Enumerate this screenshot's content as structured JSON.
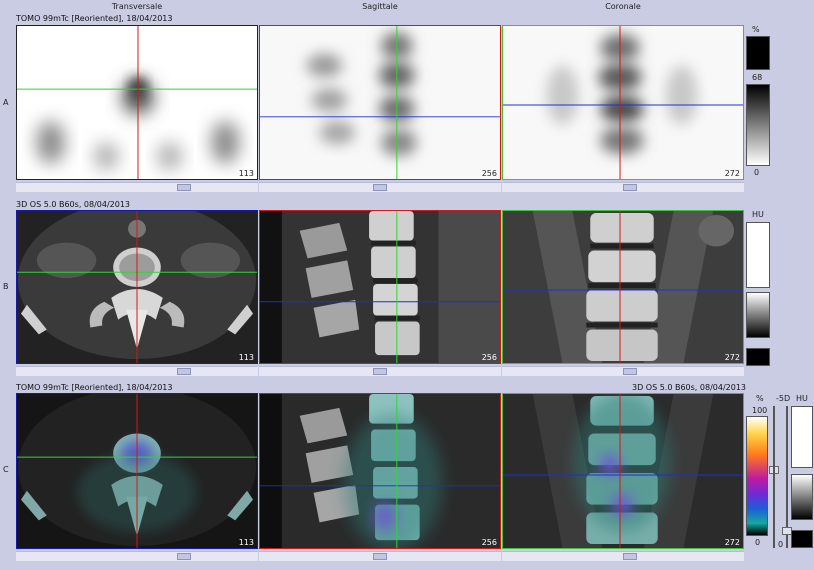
{
  "columns": {
    "transversal": "Transversale",
    "sagittal": "Sagittale",
    "coronal": "Coronale"
  },
  "rows": {
    "a": "A",
    "b": "B",
    "c": "C"
  },
  "series": {
    "spect": "TOMO 99mTc [Reoriented], 18/04/2013",
    "ct": "3D  OS  5.0  B60s, 08/04/2013",
    "fusion_spect": "TOMO 99mTc [Reoriented], 18/04/2013",
    "fusion_ct": "3D  OS  5.0  B60s, 08/04/2013"
  },
  "slices": {
    "transversal": "113",
    "sagittal": "256",
    "coronal": "272"
  },
  "colorbars": {
    "spect_unit": "%",
    "spect_value": "68",
    "spect_min": "0",
    "ct_unit": "HU",
    "fusion_unit": "%",
    "fusion_max": "100",
    "fusion_min": "0",
    "fusion_ct_unit": "HU",
    "fusion_ct_left_label": "-5D",
    "fusion_ct_right_label": "0"
  },
  "colors": {
    "crosshair_red": "#d01a1a",
    "crosshair_green": "#2fd62f",
    "crosshair_blue": "#1b2fd8",
    "frame_blue": "#1818a8",
    "frame_red": "#d01a1a",
    "frame_green": "#3bc43b"
  }
}
